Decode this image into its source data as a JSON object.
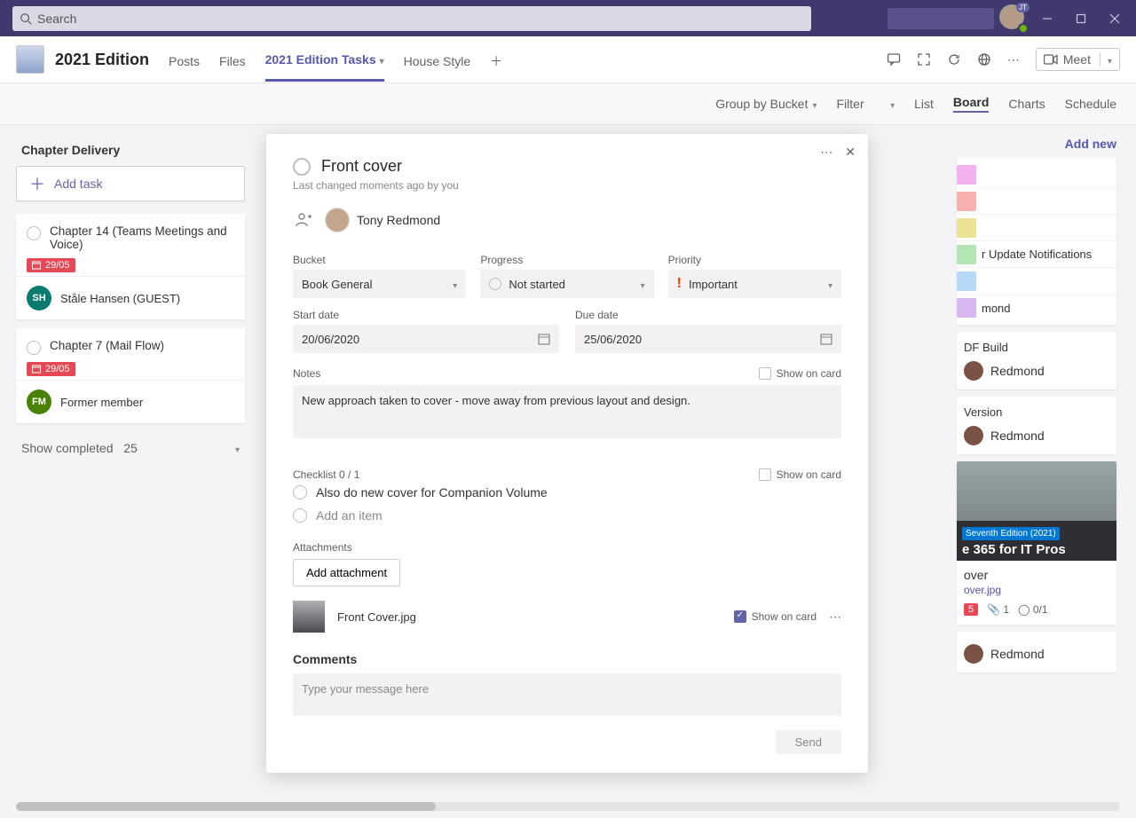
{
  "search": {
    "placeholder": "Search"
  },
  "avatar_badge": "JT",
  "channel": {
    "title": "2021 Edition"
  },
  "tabs": {
    "posts": "Posts",
    "files": "Files",
    "tasks": "2021 Edition Tasks",
    "house": "House Style"
  },
  "meet_btn": "Meet",
  "toolbar": {
    "group": "Group by Bucket",
    "filter": "Filter",
    "list": "List",
    "board": "Board",
    "charts": "Charts",
    "schedule": "Schedule"
  },
  "addnew": "Add new",
  "left": {
    "bucket": "Chapter Delivery",
    "addtask": "Add task",
    "card1": {
      "title": "Chapter 14 (Teams Meetings and Voice)",
      "due": "29/05",
      "assignee": "Ståle Hansen (GUEST)",
      "initials": "SH"
    },
    "card2": {
      "title": "Chapter 7 (Mail Flow)",
      "due": "29/05",
      "assignee": "Former member",
      "initials": "FM"
    },
    "showcomp": "Show completed",
    "showcomp_count": "25"
  },
  "labels": {
    "c1": "#f3b1ed",
    "c2": "#f6b0b0",
    "c3": "#eae396",
    "c4": "#b4e6b4",
    "c5": "#b7d8f7",
    "c6": "#d8b8f0",
    "t1": "r Update Notifications",
    "t2": "mond"
  },
  "under": {
    "pdf": "DF Build",
    "red": "Redmond",
    "ver": "Version"
  },
  "cover": {
    "edition": "Seventh Edition (2021)",
    "title2": "e 365 for IT Pros",
    "name": "over",
    "link": "over.jpg",
    "attach_n": "1",
    "chk": "0/1",
    "due": "5"
  },
  "task": {
    "title": "Front cover",
    "last": "Last changed moments ago by you",
    "assignee": "Tony Redmond",
    "bucket_lbl": "Bucket",
    "bucket_val": "Book General",
    "progress_lbl": "Progress",
    "progress_val": "Not started",
    "priority_lbl": "Priority",
    "priority_val": "Important",
    "start_lbl": "Start date",
    "start_val": "20/06/2020",
    "due_lbl": "Due date",
    "due_val": "25/06/2020",
    "notes_lbl": "Notes",
    "soc_lbl": "Show on card",
    "notes_val": "New approach taken to cover - move away from previous layout and design.",
    "checklist_lbl": "Checklist 0 / 1",
    "check_item": "Also do new cover for Companion Volume",
    "check_add": "Add an item",
    "att_lbl": "Attachments",
    "add_att": "Add attachment",
    "att_name": "Front Cover.jpg",
    "comments_lbl": "Comments",
    "comment_ph": "Type your message here",
    "send": "Send"
  }
}
